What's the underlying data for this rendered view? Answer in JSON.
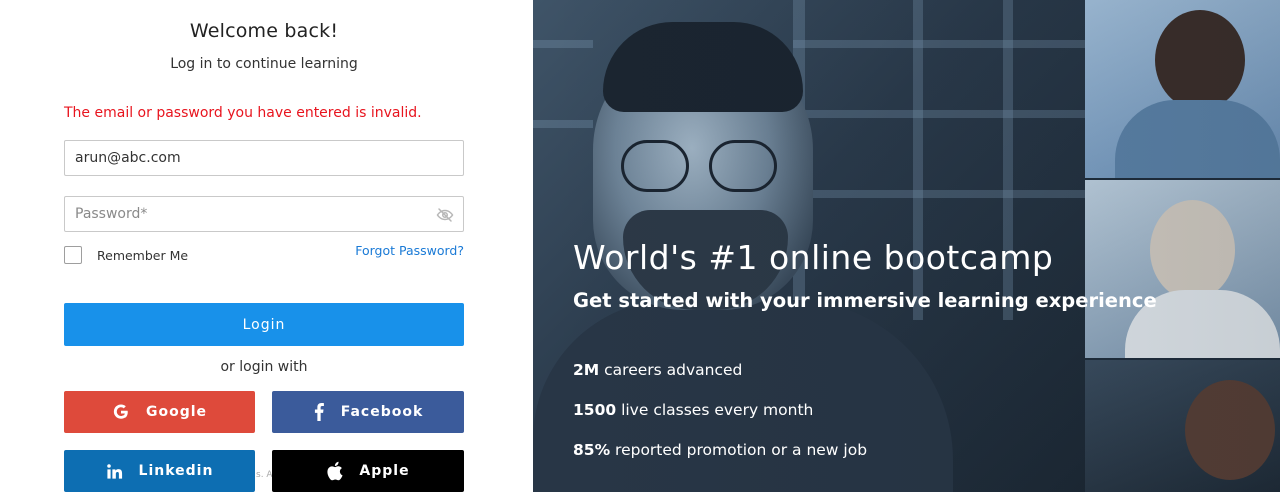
{
  "login": {
    "title": "Welcome back!",
    "subtitle": "Log in to continue learning",
    "error": "The email or password you have entered is invalid.",
    "email_value": "arun@abc.com",
    "password_placeholder": "Password*",
    "remember_label": "Remember Me",
    "forgot_label": "Forgot Password?",
    "login_label": "Login",
    "or_label": "or login with",
    "social": {
      "google": "Google",
      "facebook": "Facebook",
      "linkedin": "Linkedin",
      "apple": "Apple"
    },
    "partial_hidden_text": "s. A"
  },
  "hero": {
    "title": "World's #1 online bootcamp",
    "subtitle": "Get started with your immersive learning experience",
    "stats": [
      {
        "value": "2M",
        "text": " careers advanced"
      },
      {
        "value": "1500",
        "text": " live classes every month"
      },
      {
        "value": "85%",
        "text": " reported promotion or a new job"
      }
    ]
  },
  "colors": {
    "error": "#e8141e",
    "login_button": "#1891ea",
    "google": "#de4a3b",
    "facebook": "#3b5b9b",
    "linkedin": "#0d6eb2",
    "apple": "#000000",
    "link": "#1a7ad6"
  },
  "icons": [
    "eye-slash-icon",
    "google-icon",
    "facebook-icon",
    "linkedin-icon",
    "apple-icon"
  ]
}
